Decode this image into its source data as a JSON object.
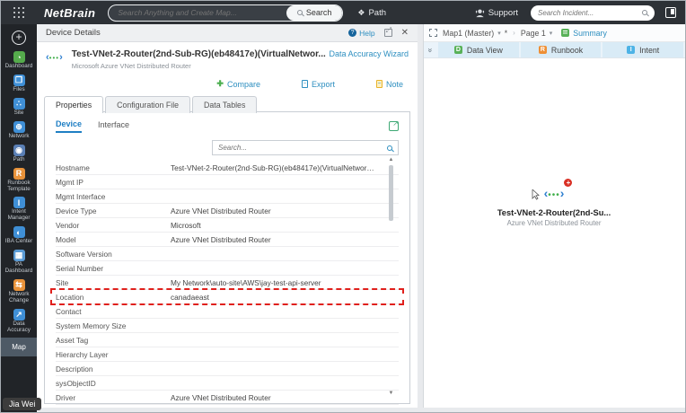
{
  "topbar": {
    "logo": "NetBrain",
    "search_placeholder": "Search Anything and Create Map...",
    "search_button": "Search",
    "path_label": "Path",
    "path_glyph": "❖",
    "support_label": "Support",
    "incident_placeholder": "Search Incident..."
  },
  "sidebar": {
    "items": [
      {
        "icon": "dashboard-icon",
        "glyph": "◔",
        "color": "#55ab4c",
        "label": "Dashboard"
      },
      {
        "icon": "files-icon",
        "glyph": "❐",
        "color": "#3f8fd6",
        "label": "Files"
      },
      {
        "icon": "site-icon",
        "glyph": "∴",
        "color": "#3f8fd6",
        "label": "Site"
      },
      {
        "icon": "network-icon",
        "glyph": "⊕",
        "color": "#3f8fd6",
        "label": "Network"
      },
      {
        "icon": "path-icon",
        "glyph": "◉",
        "color": "#5a7fb5",
        "label": "Path"
      },
      {
        "icon": "runbook-template-icon",
        "glyph": "R",
        "color": "#e8923a",
        "label": "Runbook Template"
      },
      {
        "icon": "intent-manager-icon",
        "glyph": "I",
        "color": "#3f8fd6",
        "label": "Intent Manager"
      },
      {
        "icon": "iba-center-icon",
        "glyph": "◐",
        "color": "#3f8fd6",
        "label": "IBA Center"
      },
      {
        "icon": "pa-dashboard-icon",
        "glyph": "▦",
        "color": "#5a9bd5",
        "label": "PA Dashboard"
      },
      {
        "icon": "network-change-icon",
        "glyph": "⇆",
        "color": "#e8923a",
        "label": "Network Change"
      },
      {
        "icon": "data-accuracy-icon",
        "glyph": "↗",
        "color": "#3f8fd6",
        "label": "Data Accuracy"
      }
    ],
    "map_item_label": "Map",
    "user_label": "Jia Wei"
  },
  "device_details": {
    "title": "Device Details",
    "help_label": "Help",
    "device_name": "Test-VNet-2-Router(2nd-Sub-RG)(eb48417e)(VirtualNetwor...",
    "device_subtitle": "Microsoft Azure VNet Distributed Router",
    "wizard_link": "Data Accuracy Wizard",
    "actions": {
      "compare": "Compare",
      "export": "Export",
      "note": "Note"
    },
    "tabs": [
      {
        "label": "Properties",
        "active": true
      },
      {
        "label": "Configuration File"
      },
      {
        "label": "Data Tables"
      }
    ],
    "subtabs": [
      {
        "label": "Device",
        "active": true
      },
      {
        "label": "Interface"
      }
    ],
    "search_placeholder": "Search...",
    "properties": [
      {
        "label": "Hostname",
        "value": "Test-VNet-2-Router(2nd-Sub-RG)(eb48417e)(VirtualNetwork..."
      },
      {
        "label": "Mgmt IP",
        "value": ""
      },
      {
        "label": "Mgmt Interface",
        "value": ""
      },
      {
        "label": "Device Type",
        "value": "Azure VNet Distributed Router"
      },
      {
        "label": "Vendor",
        "value": "Microsoft"
      },
      {
        "label": "Model",
        "value": "Azure VNet Distributed Router"
      },
      {
        "label": "Software Version",
        "value": ""
      },
      {
        "label": "Serial Number",
        "value": ""
      },
      {
        "label": "Site",
        "value": "My Network\\auto-site\\AWS\\jay-test-api-server"
      },
      {
        "label": "Location",
        "value": "canadaeast",
        "highlighted": true
      },
      {
        "label": "Contact",
        "value": ""
      },
      {
        "label": "System Memory Size",
        "value": ""
      },
      {
        "label": "Asset Tag",
        "value": ""
      },
      {
        "label": "Hierarchy Layer",
        "value": ""
      },
      {
        "label": "Description",
        "value": ""
      },
      {
        "label": "sysObjectID",
        "value": ""
      },
      {
        "label": "Driver",
        "value": "Azure VNet Distributed Router"
      }
    ]
  },
  "map_panel": {
    "map_name": "Map1 (Master)",
    "modified_marker": "*",
    "crumb_separator": "›",
    "page_name": "Page 1",
    "summary_label": "Summary",
    "tabs": [
      {
        "icon": "data-view-icon",
        "letter": "D",
        "color": "#58b158",
        "label": "Data View"
      },
      {
        "icon": "runbook-icon",
        "letter": "R",
        "color": "#ee8f35",
        "label": "Runbook"
      },
      {
        "icon": "intent-icon",
        "letter": "I",
        "color": "#4db3e6",
        "label": "Intent"
      }
    ],
    "device": {
      "name": "Test-VNet-2-Router(2nd-Su...",
      "type": "Azure VNet Distributed Router"
    }
  },
  "colors": {
    "accent_blue": "#2e8fc0",
    "highlight_red": "#e0201c",
    "topbar_bg": "#2d3136",
    "sidebar_bg": "#212428"
  }
}
